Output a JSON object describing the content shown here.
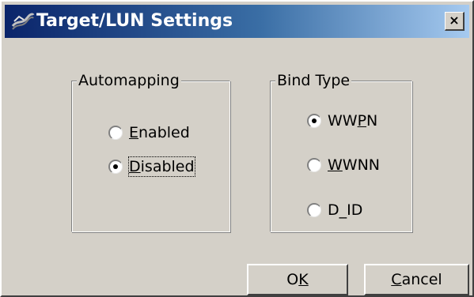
{
  "window": {
    "title": "Target/LUN Settings",
    "close_glyph": "×"
  },
  "automapping": {
    "legend": "Automapping",
    "options": [
      {
        "pre": "",
        "accel": "E",
        "post": "nabled",
        "checked": false
      },
      {
        "pre": "",
        "accel": "D",
        "post": "isabled",
        "checked": true
      }
    ]
  },
  "bind_type": {
    "legend": "Bind Type",
    "options": [
      {
        "pre": "WW",
        "accel": "P",
        "post": "N",
        "checked": true
      },
      {
        "pre": "",
        "accel": "W",
        "post": "WNN",
        "checked": false
      },
      {
        "pre": "D",
        "accel": "_I",
        "post": "D",
        "checked": false
      }
    ]
  },
  "buttons": {
    "ok": {
      "pre": "O",
      "accel": "K",
      "post": ""
    },
    "cancel": {
      "pre": "",
      "accel": "C",
      "post": "ancel"
    }
  },
  "icons": {
    "title": "fibre-channel-icon",
    "close": "close-icon"
  },
  "colors": {
    "face": "#d4d0c8",
    "titlebar_start": "#0a246a",
    "titlebar_end": "#a6caf0"
  }
}
